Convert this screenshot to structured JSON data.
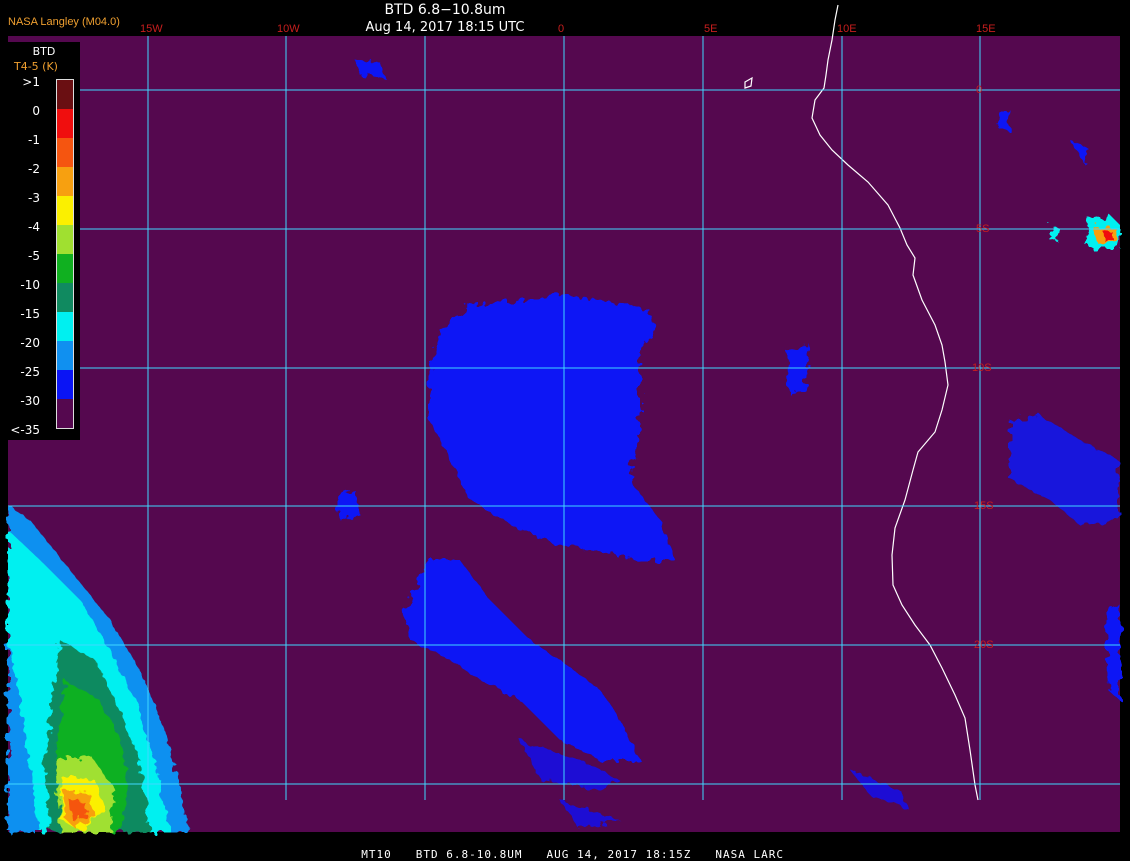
{
  "credit": "NASA Langley (M04.0)",
  "title": "BTD 6.8−10.8um",
  "subtitle": "Aug 14, 2017 18:15 UTC",
  "footer": {
    "product": "MT10",
    "channel": "BTD 6.8-10.8UM",
    "datetime": "AUG 14, 2017 18:15Z",
    "source": "NASA LARC"
  },
  "legend": {
    "title": "BTD",
    "subtitle": "T4-5 (K)",
    "labels": [
      ">1",
      "0",
      "-1",
      "-2",
      "-3",
      "-4",
      "-5",
      "-10",
      "-15",
      "-20",
      "-25",
      "-30",
      "<-35"
    ],
    "colors": [
      "#6a0f12",
      "#f00e0e",
      "#f55510",
      "#f7a010",
      "#fbf000",
      "#a0e030",
      "#10b020",
      "#108a60",
      "#00f0f0",
      "#1090f0",
      "#0a14f5",
      "#55084f"
    ]
  },
  "colors": {
    "background": "#55084f",
    "grid": "#40d8ff",
    "coast": "#ffffff",
    "label": "#c81e1e"
  },
  "grid": {
    "lon_labels": [
      "15W",
      "10W",
      "0",
      "5E",
      "10E",
      "15E"
    ],
    "lat_labels": [
      "0",
      "5S",
      "10S",
      "15S",
      "20S"
    ]
  }
}
